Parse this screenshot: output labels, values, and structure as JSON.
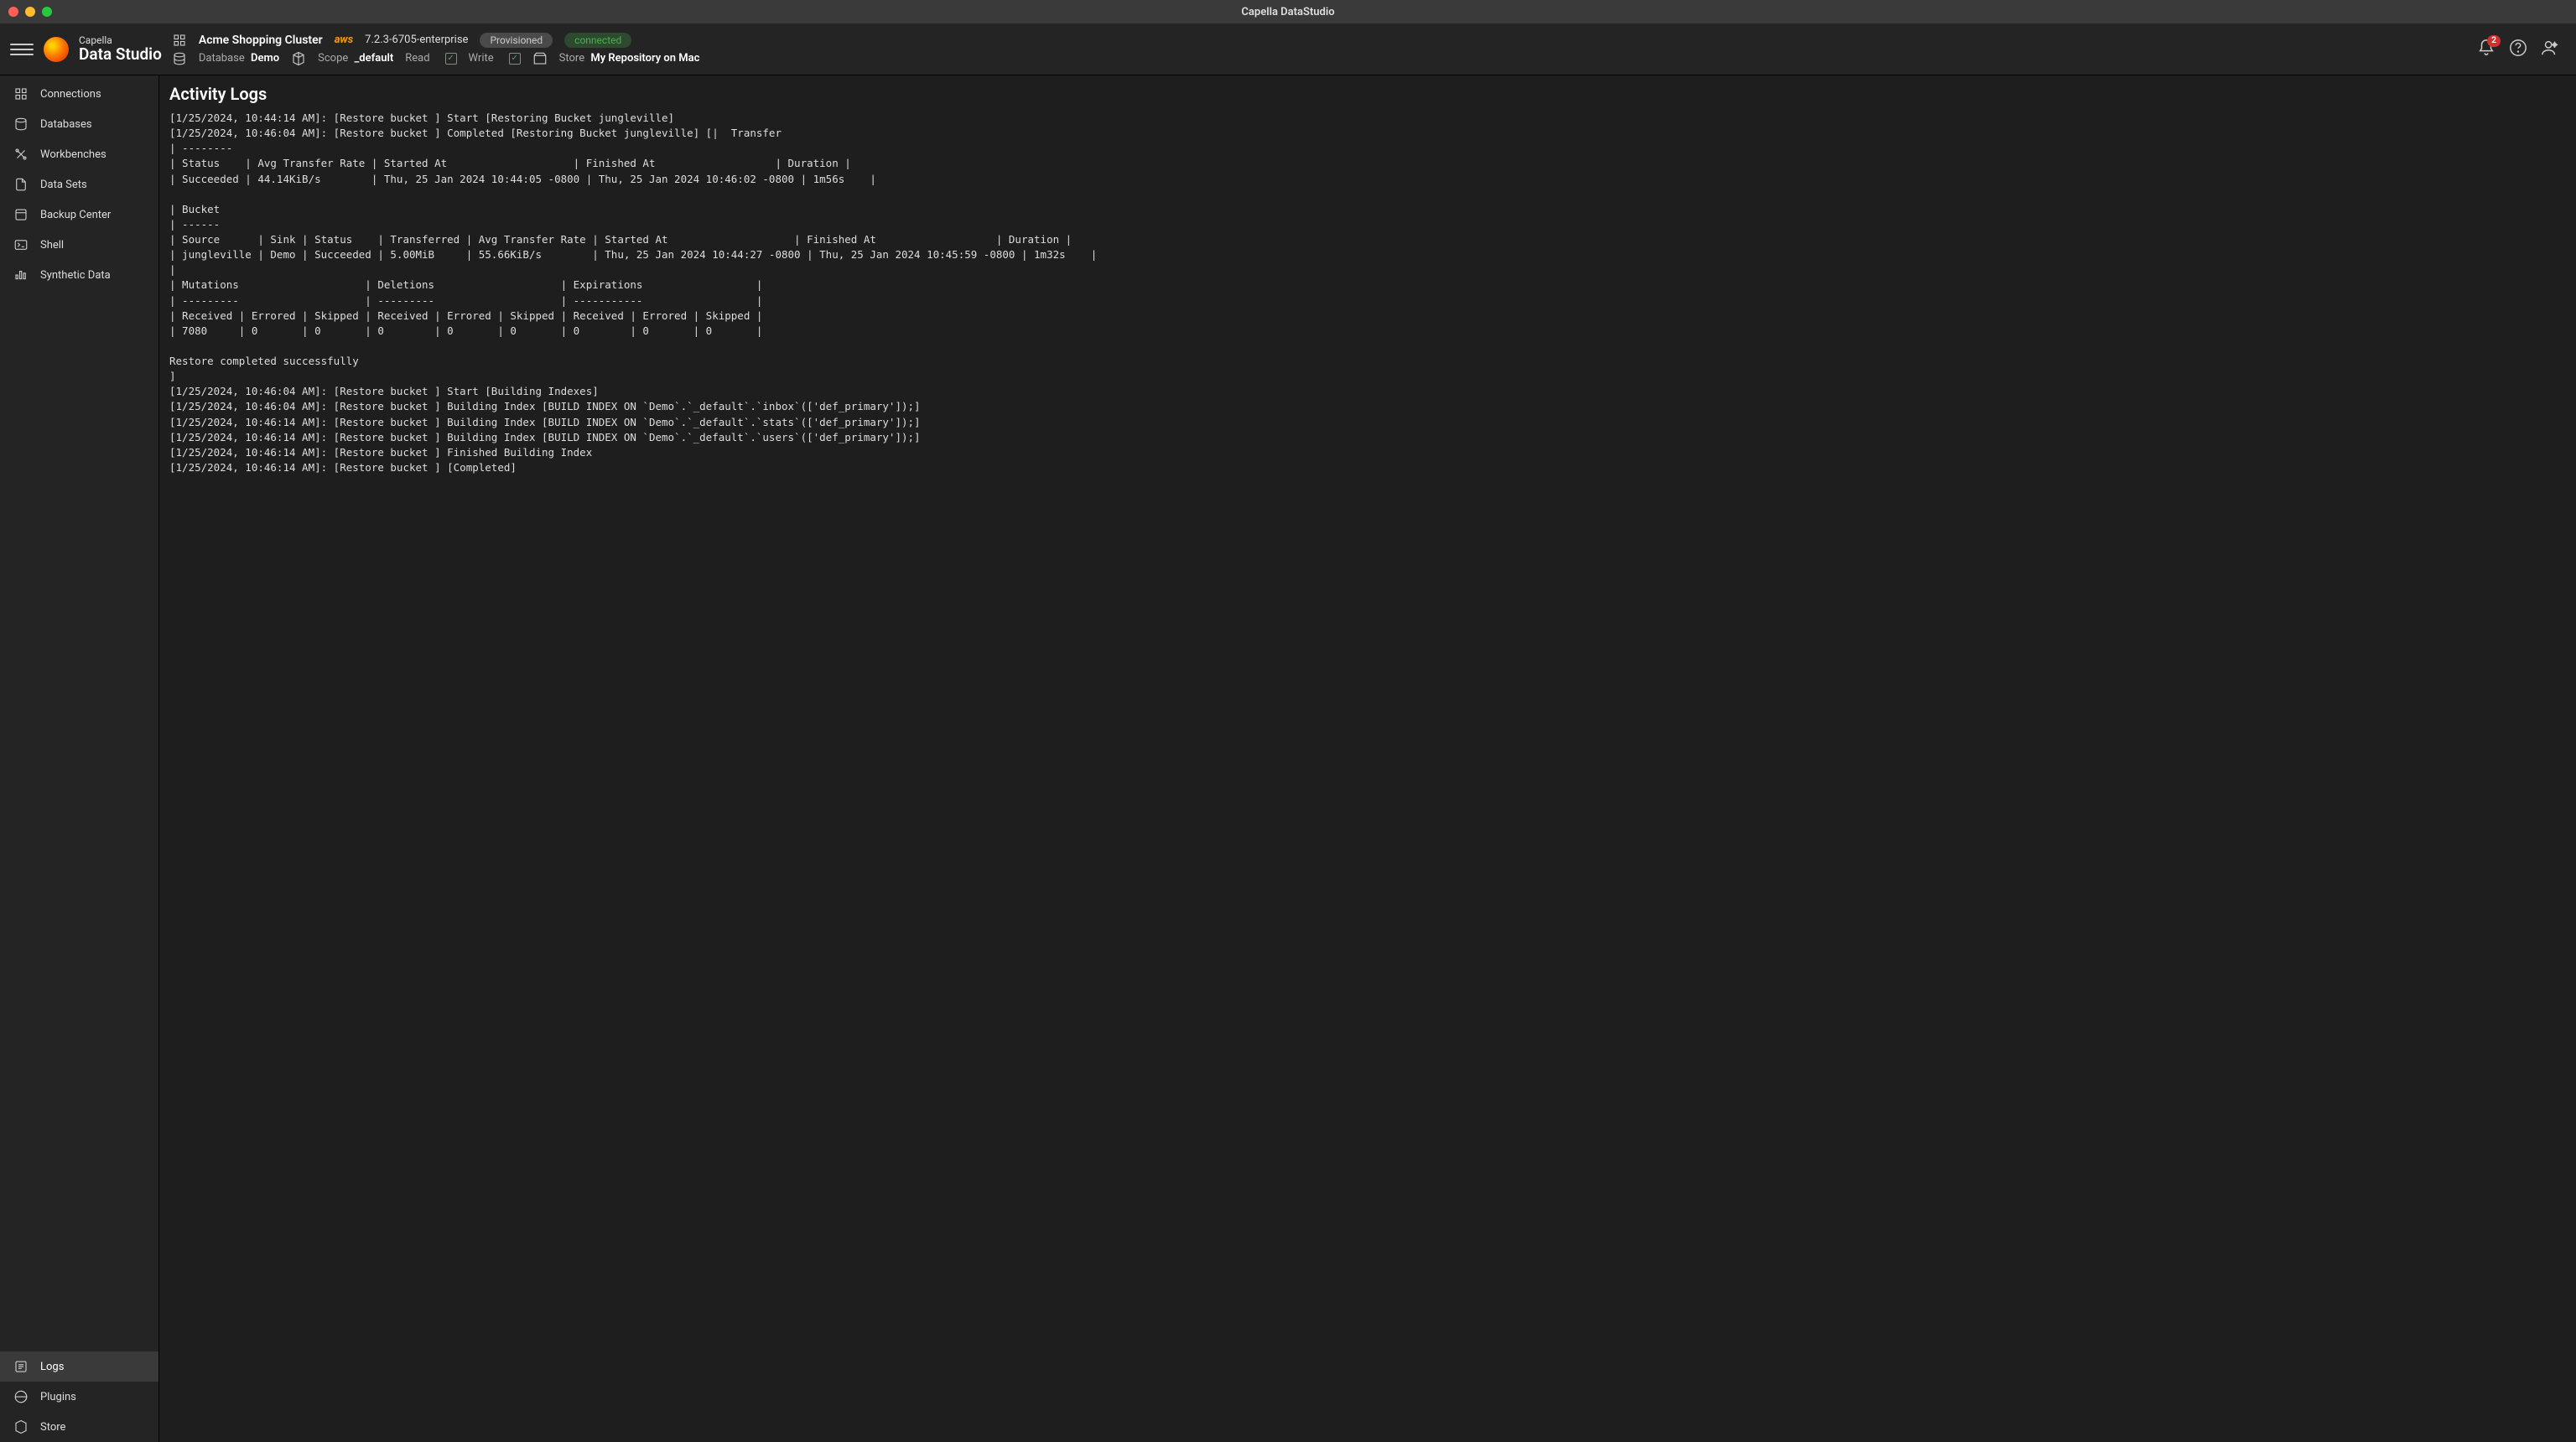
{
  "window": {
    "title": "Capella DataStudio"
  },
  "brand": {
    "top": "Capella",
    "bottom": "Data Studio"
  },
  "header": {
    "cluster": "Acme Shopping Cluster",
    "provider": "aws",
    "version": "7.2.3-6705-enterprise",
    "status1": "Provisioned",
    "status2": "connected",
    "database_label": "Database",
    "database_value": "Demo",
    "scope_label": "Scope",
    "scope_value": "_default",
    "read_label": "Read",
    "write_label": "Write",
    "store_label": "Store",
    "store_value": "My Repository on Mac",
    "badge": "2"
  },
  "sidebar": {
    "top": [
      {
        "label": "Connections"
      },
      {
        "label": "Databases"
      },
      {
        "label": "Workbenches"
      },
      {
        "label": "Data Sets"
      },
      {
        "label": "Backup Center"
      },
      {
        "label": "Shell"
      },
      {
        "label": "Synthetic Data"
      }
    ],
    "bottom": [
      {
        "label": "Logs"
      },
      {
        "label": "Plugins"
      },
      {
        "label": "Store"
      }
    ]
  },
  "content": {
    "title": "Activity Logs",
    "log": "[1/25/2024, 10:44:14 AM]: [Restore bucket ] Start [Restoring Bucket jungleville]\n[1/25/2024, 10:46:04 AM]: [Restore bucket ] Completed [Restoring Bucket jungleville] [|  Transfer\n| --------\n| Status    | Avg Transfer Rate | Started At                    | Finished At                   | Duration |\n| Succeeded | 44.14KiB/s        | Thu, 25 Jan 2024 10:44:05 -0800 | Thu, 25 Jan 2024 10:46:02 -0800 | 1m56s    |\n\n| Bucket\n| ------\n| Source      | Sink | Status    | Transferred | Avg Transfer Rate | Started At                    | Finished At                   | Duration |\n| jungleville | Demo | Succeeded | 5.00MiB     | 55.66KiB/s        | Thu, 25 Jan 2024 10:44:27 -0800 | Thu, 25 Jan 2024 10:45:59 -0800 | 1m32s    |\n|\n| Mutations                    | Deletions                    | Expirations                  |\n| ---------                    | ---------                    | -----------                  |\n| Received | Errored | Skipped | Received | Errored | Skipped | Received | Errored | Skipped |\n| 7080     | 0       | 0       | 0        | 0       | 0       | 0        | 0       | 0       |\n\nRestore completed successfully\n]\n[1/25/2024, 10:46:04 AM]: [Restore bucket ] Start [Building Indexes]\n[1/25/2024, 10:46:04 AM]: [Restore bucket ] Building Index [BUILD INDEX ON `Demo`.`_default`.`inbox`(['def_primary']);]\n[1/25/2024, 10:46:14 AM]: [Restore bucket ] Building Index [BUILD INDEX ON `Demo`.`_default`.`stats`(['def_primary']);]\n[1/25/2024, 10:46:14 AM]: [Restore bucket ] Building Index [BUILD INDEX ON `Demo`.`_default`.`users`(['def_primary']);]\n[1/25/2024, 10:46:14 AM]: [Restore bucket ] Finished Building Index\n[1/25/2024, 10:46:14 AM]: [Restore bucket ] [Completed]"
  }
}
